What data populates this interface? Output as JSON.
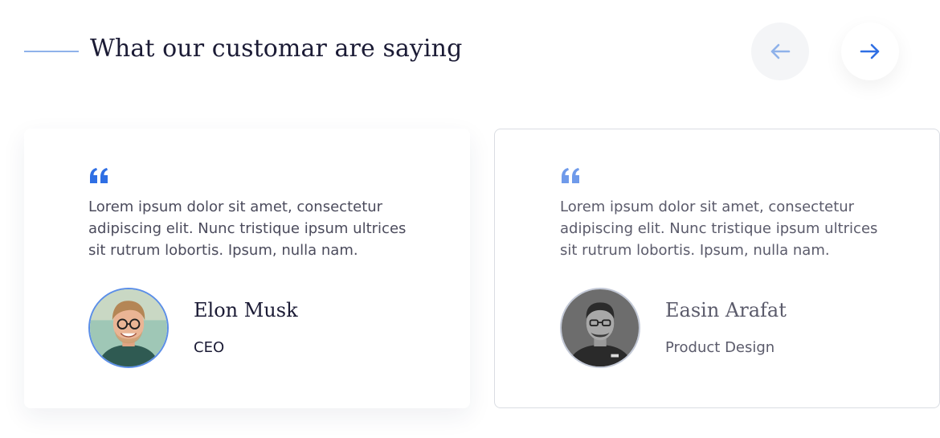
{
  "section": {
    "title": "What our customar are saying"
  },
  "navigation": {
    "prev_icon": "arrow-left-icon",
    "next_icon": "arrow-right-icon"
  },
  "testimonials": [
    {
      "quote": "Lorem ipsum dolor sit amet, consectetur adipiscing elit. Nunc tristique ipsum ultrices sit rutrum lobortis. Ipsum, nulla nam.",
      "name": "Elon Musk",
      "role": "CEO",
      "avatar_icon": "avatar-photo"
    },
    {
      "quote": "Lorem ipsum dolor sit amet, consectetur adipiscing elit. Nunc tristique ipsum ultrices sit rutrum lobortis. Ipsum, nulla nam.",
      "name": "Easin Arafat",
      "role": "Product Design",
      "avatar_icon": "avatar-photo"
    }
  ],
  "colors": {
    "accent": "#2f6fe4",
    "accent_light": "#8fb2ea",
    "heading": "#1b1b35",
    "body_text": "#4b4b5c",
    "muted_text": "#5b5b6b",
    "nav_prev_bg": "#f4f5f7"
  }
}
